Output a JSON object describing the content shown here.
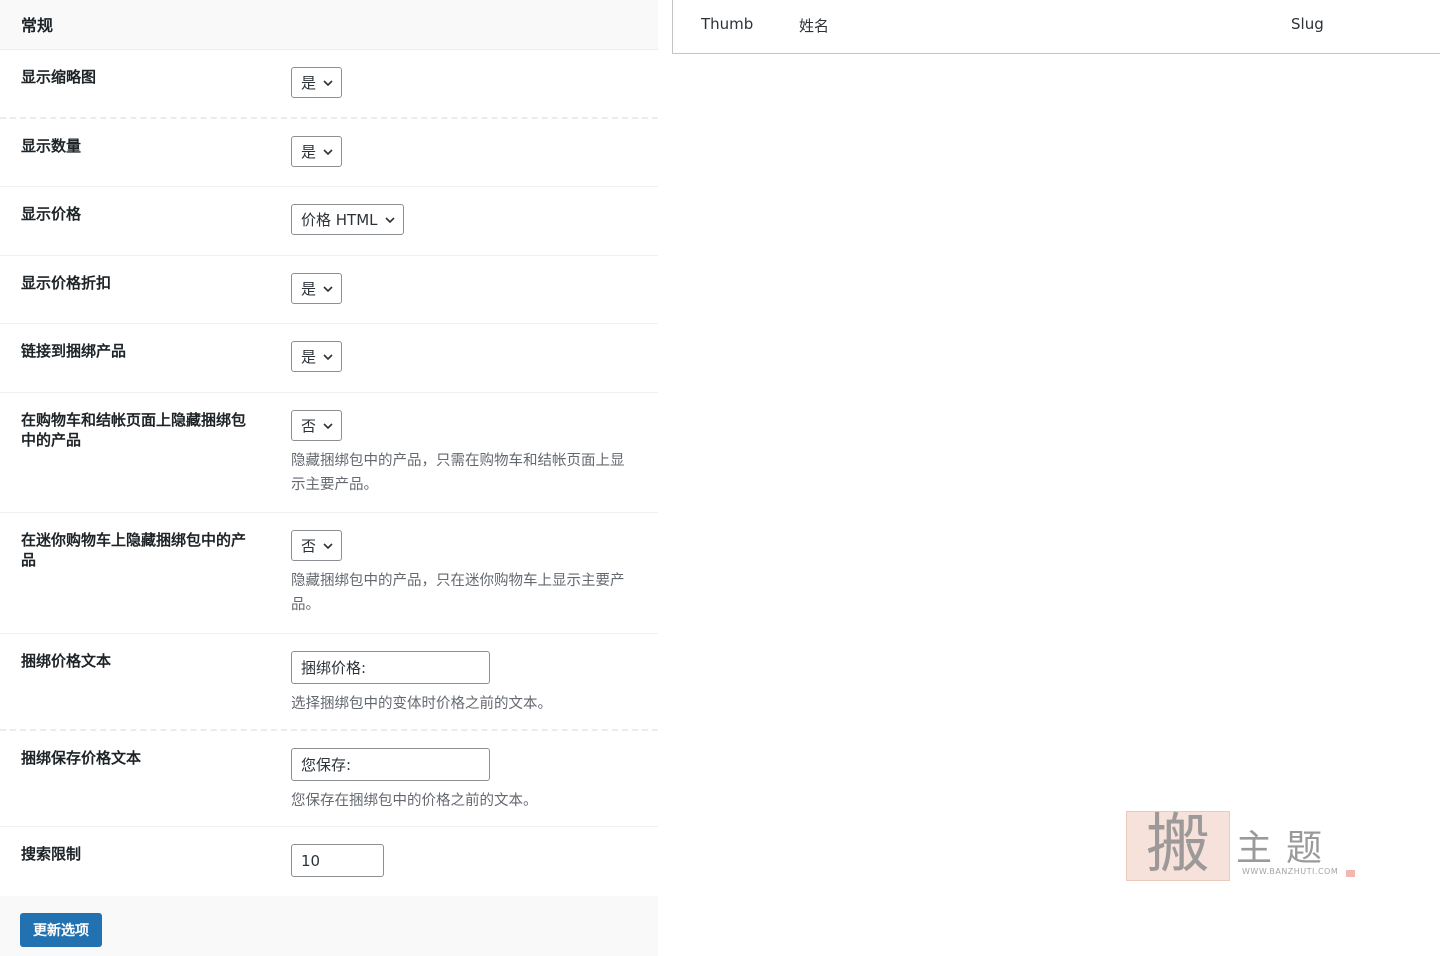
{
  "settings": {
    "section_title": "常规",
    "rows": [
      {
        "label": "显示缩略图",
        "type": "select",
        "value": "是"
      },
      {
        "label": "显示数量",
        "type": "select",
        "value": "是"
      },
      {
        "label": "显示价格",
        "type": "select",
        "value": "价格 HTML"
      },
      {
        "label": "显示价格折扣",
        "type": "select",
        "value": "是"
      },
      {
        "label": "链接到捆绑产品",
        "type": "select",
        "value": "是"
      },
      {
        "label": "在购物车和结帐页面上隐藏捆绑包中的产品",
        "type": "select",
        "value": "否",
        "description": "隐藏捆绑包中的产品，只需在购物车和结帐页面上显示主要产品。"
      },
      {
        "label": "在迷你购物车上隐藏捆绑包中的产品",
        "type": "select",
        "value": "否",
        "description": "隐藏捆绑包中的产品，只在迷你购物车上显示主要产品。"
      },
      {
        "label": "捆绑价格文本",
        "type": "text",
        "value": "捆绑价格:",
        "description": "选择捆绑包中的变体时价格之前的文本。"
      },
      {
        "label": "捆绑保存价格文本",
        "type": "text",
        "value": "您保存:",
        "description": "您保存在捆绑包中的价格之前的文本。"
      },
      {
        "label": "搜索限制",
        "type": "number",
        "value": "10"
      }
    ],
    "submit_label": "更新选项"
  },
  "table": {
    "columns": [
      "Thumb",
      "姓名",
      "Slug"
    ]
  },
  "watermark": {
    "seal_char": "搬",
    "brand": "主题",
    "site": "WWW.BANZHUTI.COM"
  },
  "icons": {
    "select_arrow": "chevron-down-icon"
  },
  "colors": {
    "primary": "#2271b1",
    "muted_text": "#646970",
    "border": "#8c8f94"
  }
}
